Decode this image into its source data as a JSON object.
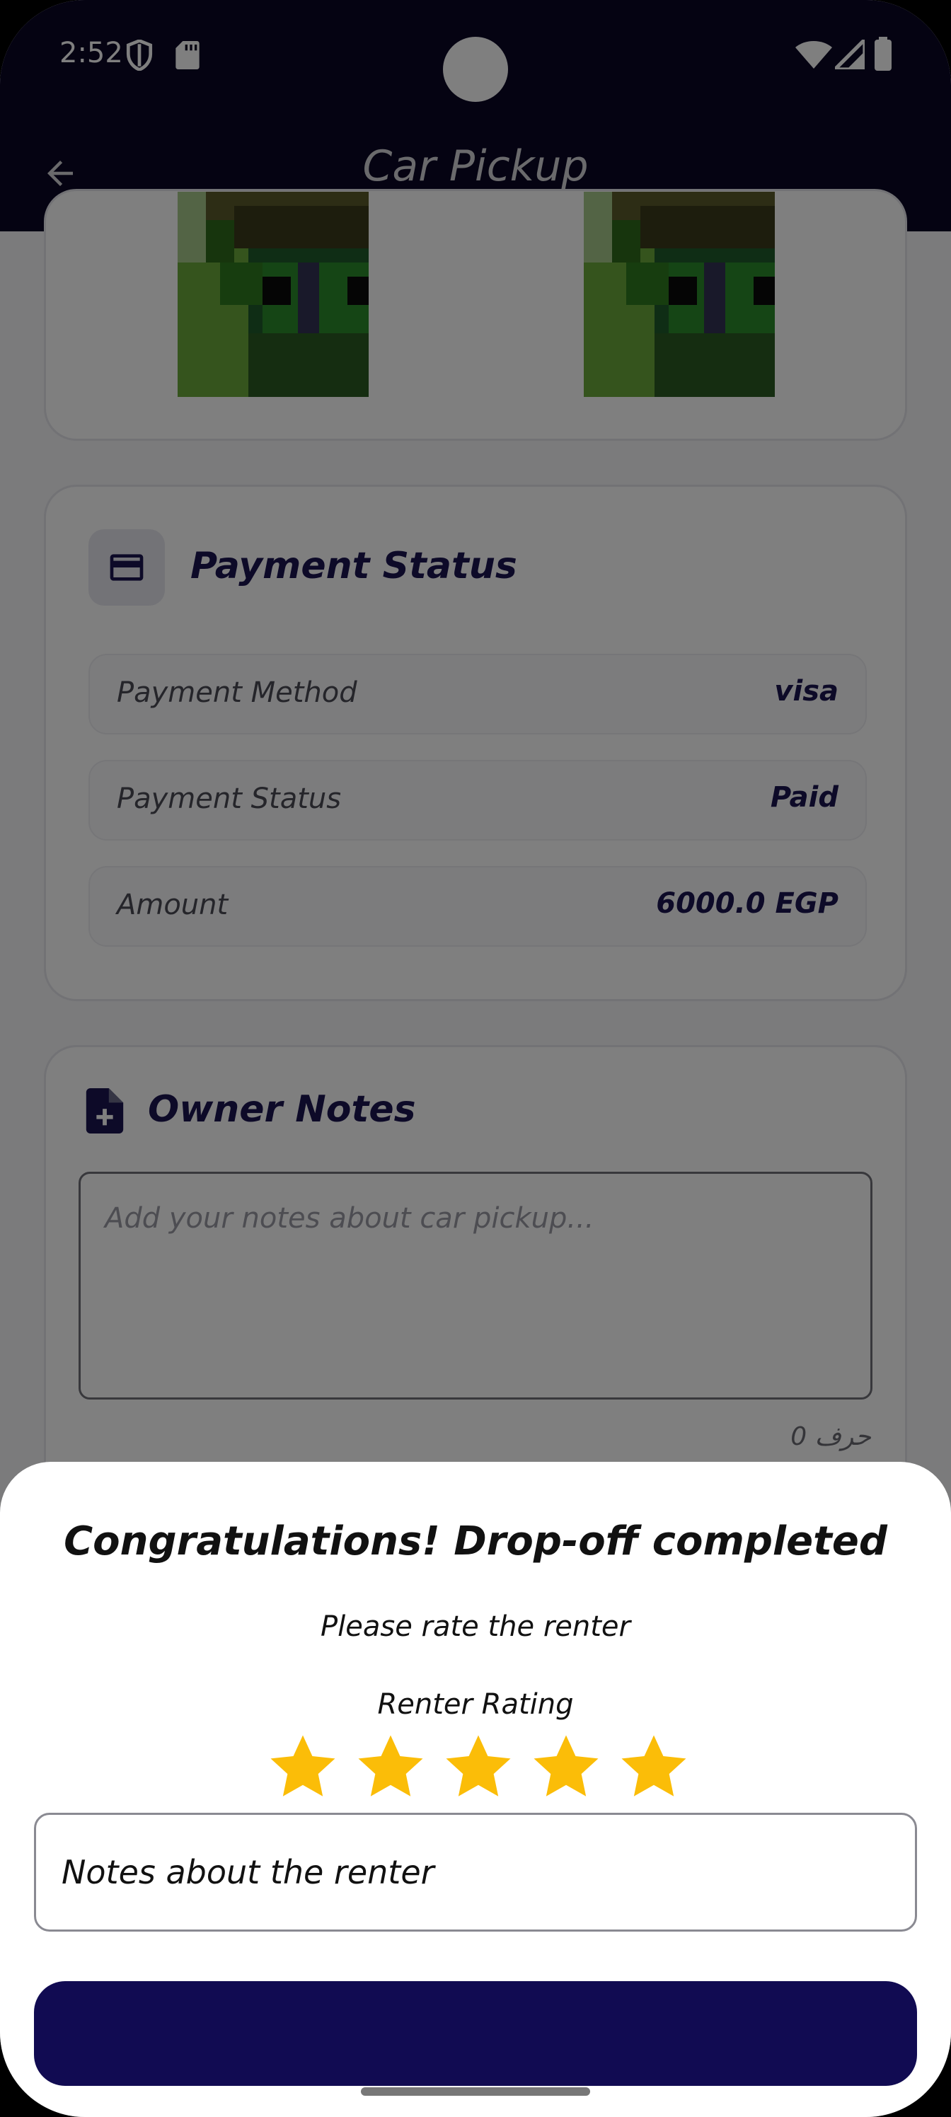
{
  "status_bar": {
    "time": "2:52",
    "icons": [
      "shield-icon",
      "sd-card-icon",
      "wifi-icon",
      "signal-icon",
      "battery-icon"
    ]
  },
  "app_bar": {
    "title": "Car Pickup",
    "back_icon": "arrow-back-icon"
  },
  "payment": {
    "title": "Payment Status",
    "icon": "credit-card-icon",
    "rows": [
      {
        "label": "Payment Method",
        "value": "visa"
      },
      {
        "label": "Payment Status",
        "value": "Paid"
      },
      {
        "label": "Amount",
        "value": "6000.0 EGP"
      }
    ]
  },
  "owner_notes": {
    "title": "Owner Notes",
    "icon": "note-add-icon",
    "placeholder": "Add your notes about car pickup...",
    "char_count": "0 حرف"
  },
  "sheet": {
    "title": "Congratulations! Drop-off completed",
    "subtitle": "Please rate the renter",
    "rating_label": "Renter Rating",
    "rating": 5,
    "rating_max": 5,
    "notes_label": "Notes about the renter",
    "submit_label": ""
  },
  "colors": {
    "primary": "#0a0624",
    "button": "#110b52",
    "star": "#fbbd08",
    "accent_text": "#1a1450"
  }
}
